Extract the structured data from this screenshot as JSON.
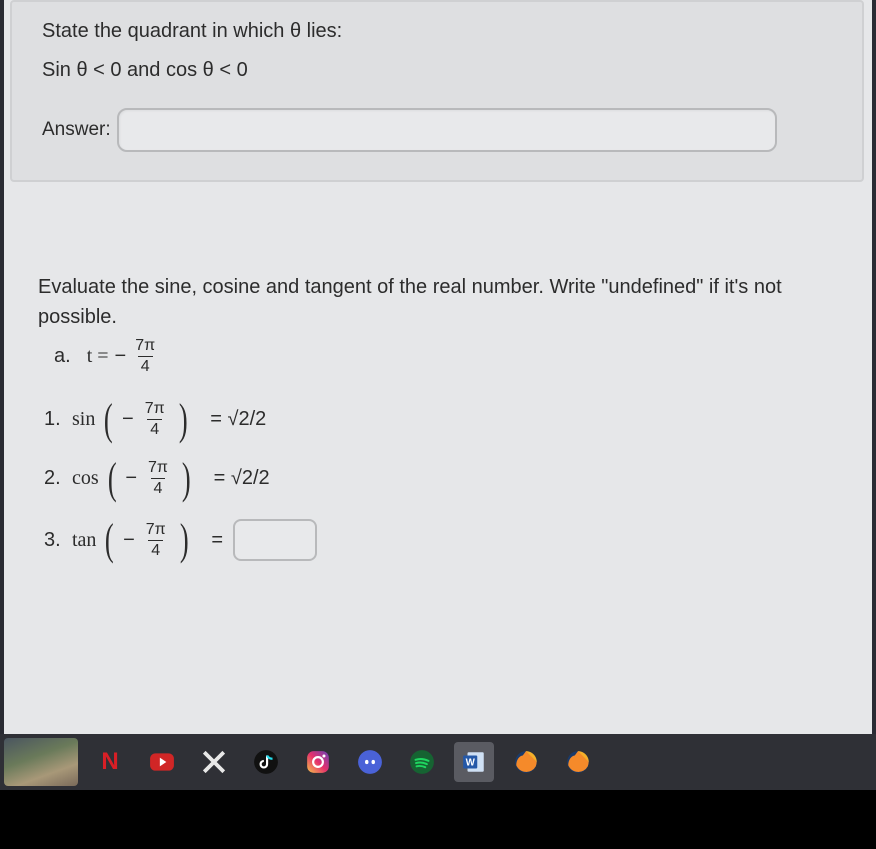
{
  "question1": {
    "prompt_line1": "State the quadrant in which θ lies:",
    "prompt_line2": "Sin θ < 0 and cos θ < 0",
    "answer_label": "Answer:",
    "answer_value": ""
  },
  "question2": {
    "prompt_full": "Evaluate the sine, cosine and tangent of the real number. Write \"undefined\" if it's not possible.",
    "part_label": "a.",
    "t_equals": "t =",
    "minus": "−",
    "frac_num": "7π",
    "frac_den": "4",
    "rows": [
      {
        "index": "1.",
        "fn": "sin",
        "result": "= √2/2",
        "input": false
      },
      {
        "index": "2.",
        "fn": "cos",
        "result": "= √2/2",
        "input": false
      },
      {
        "index": "3.",
        "fn": "tan",
        "result": "=",
        "input": true,
        "value": ""
      }
    ]
  },
  "taskbar": {
    "icons": [
      {
        "name": "desktop-thumbnail-icon"
      },
      {
        "name": "netflix-icon"
      },
      {
        "name": "youtube-icon"
      },
      {
        "name": "x-twitter-icon"
      },
      {
        "name": "tiktok-icon"
      },
      {
        "name": "instagram-icon"
      },
      {
        "name": "discord-icon"
      },
      {
        "name": "spotify-icon"
      },
      {
        "name": "word-icon"
      },
      {
        "name": "firefox-icon"
      },
      {
        "name": "firefox-dev-icon"
      }
    ]
  }
}
